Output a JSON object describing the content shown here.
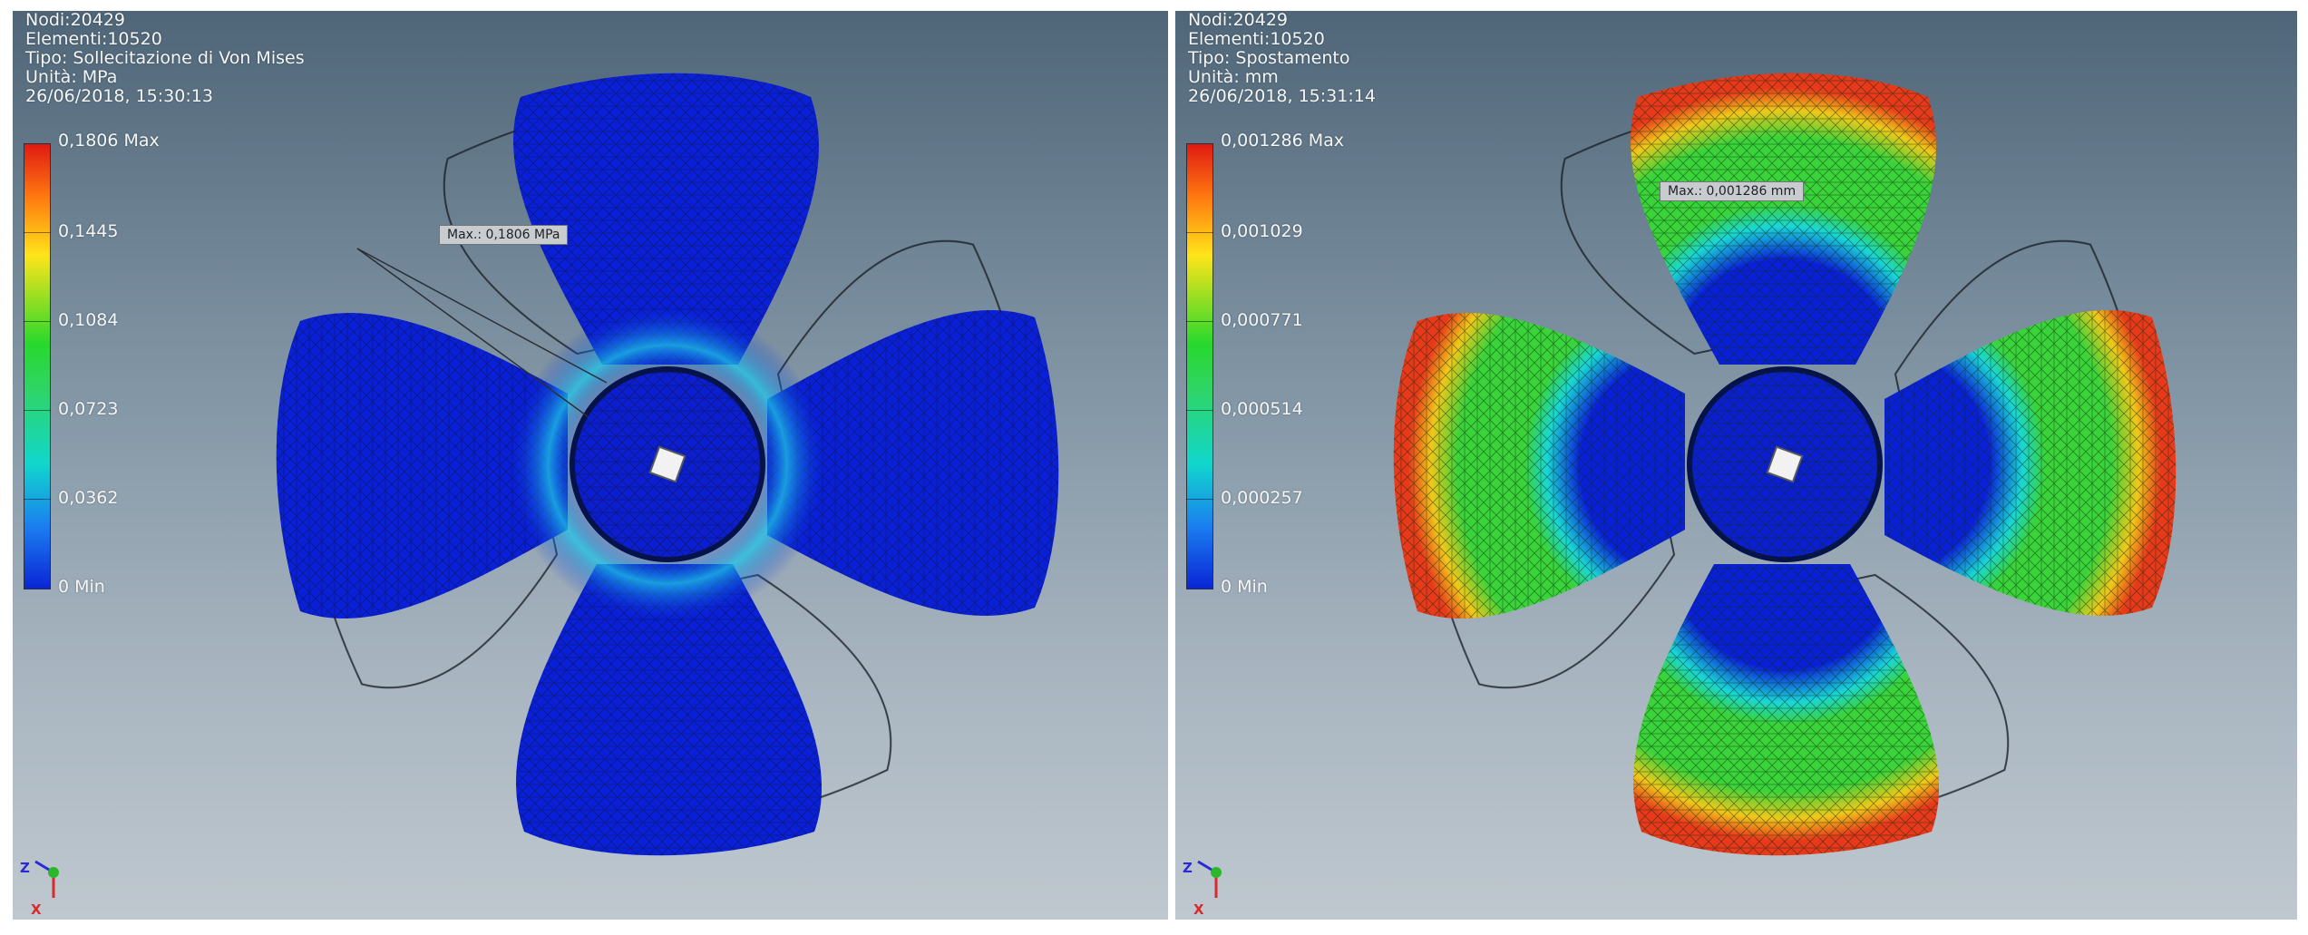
{
  "panels": [
    {
      "info": {
        "nodes": "Nodi:20429",
        "elements": "Elementi:10520",
        "type": "Tipo: Sollecitazione di Von Mises",
        "unit": "Unità: MPa",
        "timestamp": "26/06/2018, 15:30:13"
      },
      "legend": {
        "labels": [
          "0,1806 Max",
          "0,1445",
          "0,1084",
          "0,0723",
          "0,0362",
          "0 Min"
        ]
      },
      "callout": "Max.: 0,1806 MPa",
      "colors": {
        "blade": "#0a20d8",
        "hub": "#0b1fd0",
        "accent": "#19d6e0"
      },
      "triad": {
        "z": "Z",
        "x": "X"
      }
    },
    {
      "info": {
        "nodes": "Nodi:20429",
        "elements": "Elementi:10520",
        "type": "Tipo: Spostamento",
        "unit": "Unità: mm",
        "timestamp": "26/06/2018, 15:31:14"
      },
      "legend": {
        "labels": [
          "0,001286 Max",
          "0,001029",
          "0,000771",
          "0,000514",
          "0,000257",
          "0 Min"
        ]
      },
      "callout": "Max.: 0,001286 mm",
      "colors": {
        "blade": "#39d23a",
        "hub": "#0b1fd0",
        "tip": "#e8391a"
      },
      "triad": {
        "z": "Z",
        "x": "X"
      }
    }
  ]
}
